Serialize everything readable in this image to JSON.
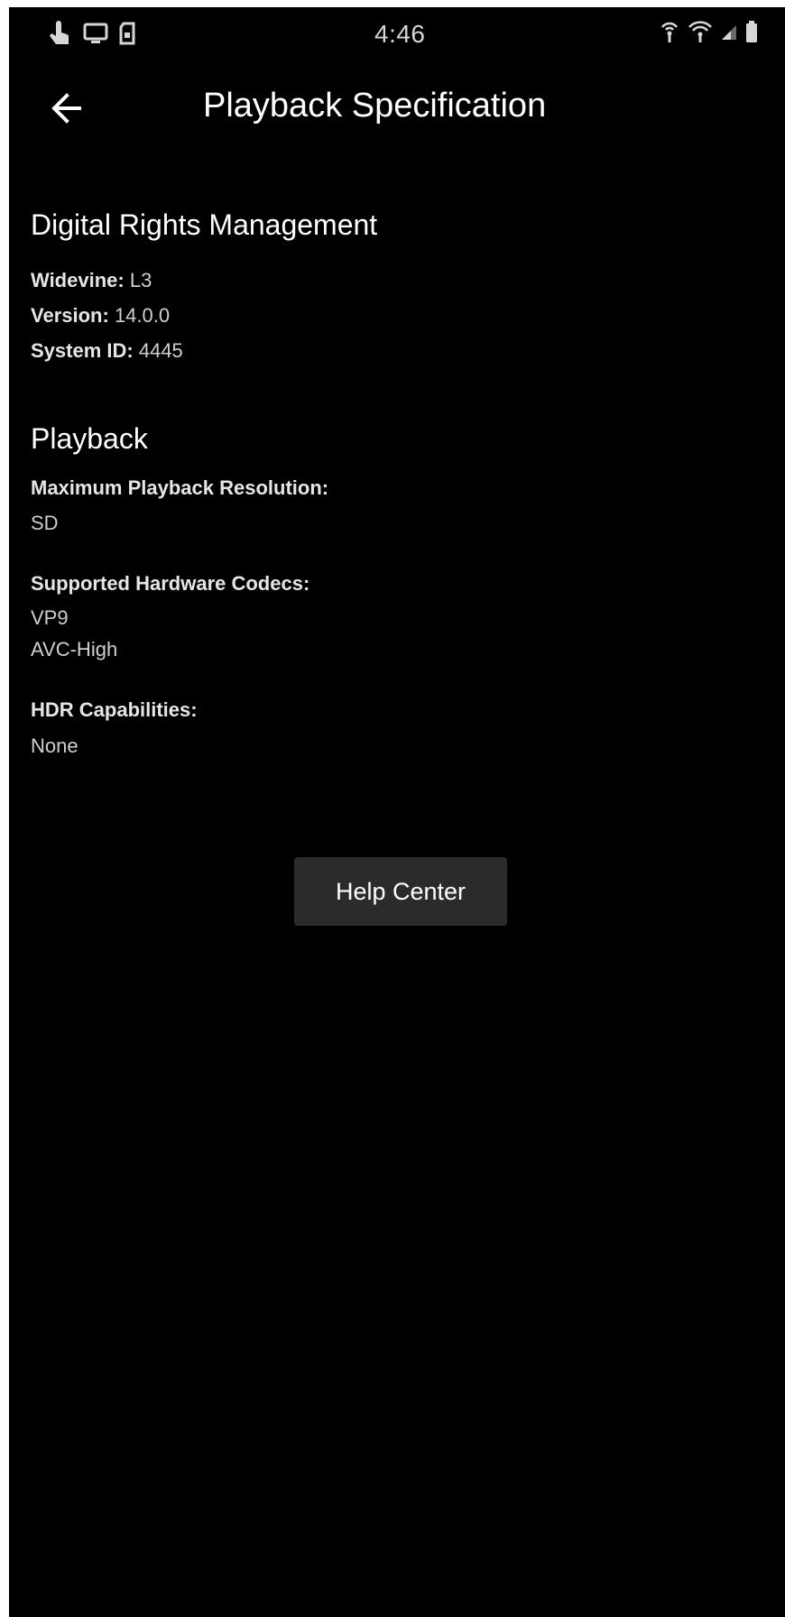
{
  "status_bar": {
    "time": "4:46",
    "left_icons": [
      "touch-icon",
      "cast-screen-icon",
      "sd-card-icon"
    ],
    "right_icons": [
      "hotspot-icon",
      "wifi-calling-icon",
      "signal-icon",
      "battery-icon"
    ]
  },
  "header": {
    "back_icon": "arrow-left-icon",
    "title": "Playback Specification"
  },
  "drm": {
    "heading": "Digital Rights Management",
    "widevine_label": "Widevine:",
    "widevine_value": "L3",
    "version_label": "Version:",
    "version_value": "14.0.0",
    "system_id_label": "System ID:",
    "system_id_value": "4445"
  },
  "playback": {
    "heading": "Playback",
    "max_resolution_label": "Maximum Playback Resolution:",
    "max_resolution_value": "SD",
    "codecs_label": "Supported Hardware Codecs:",
    "codecs": [
      "VP9",
      "AVC-High"
    ],
    "hdr_label": "HDR Capabilities:",
    "hdr_value": "None"
  },
  "help_button_label": "Help Center",
  "colors": {
    "background": "#000000",
    "text": "#ffffff",
    "secondary_text": "#cfcfcf",
    "button_bg": "#2b2b2b"
  }
}
